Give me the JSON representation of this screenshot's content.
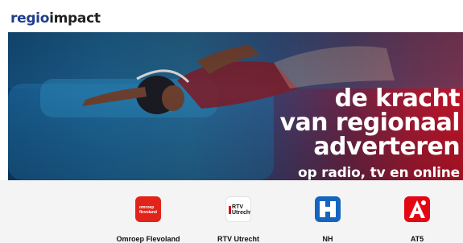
{
  "header": {
    "logo_part1": "regio",
    "logo_part2": "impact"
  },
  "hero": {
    "line1": "de kracht",
    "line2": "van regionaal",
    "line3": "adverteren",
    "subline": "op radio, tv en online"
  },
  "channels": [
    {
      "name": "Omroep Flevoland",
      "badge_text": "omroep flevoland",
      "icon": "omroep-flevoland-logo",
      "color": "#e2231a"
    },
    {
      "name": "RTV Utrecht",
      "badge_text": "RTV Utrecht",
      "icon": "rtv-utrecht-logo",
      "color": "#d4001a"
    },
    {
      "name": "NH",
      "icon": "nh-logo",
      "color": "#1565c0"
    },
    {
      "name": "AT5",
      "icon": "at5-logo",
      "color": "#e30613"
    }
  ]
}
